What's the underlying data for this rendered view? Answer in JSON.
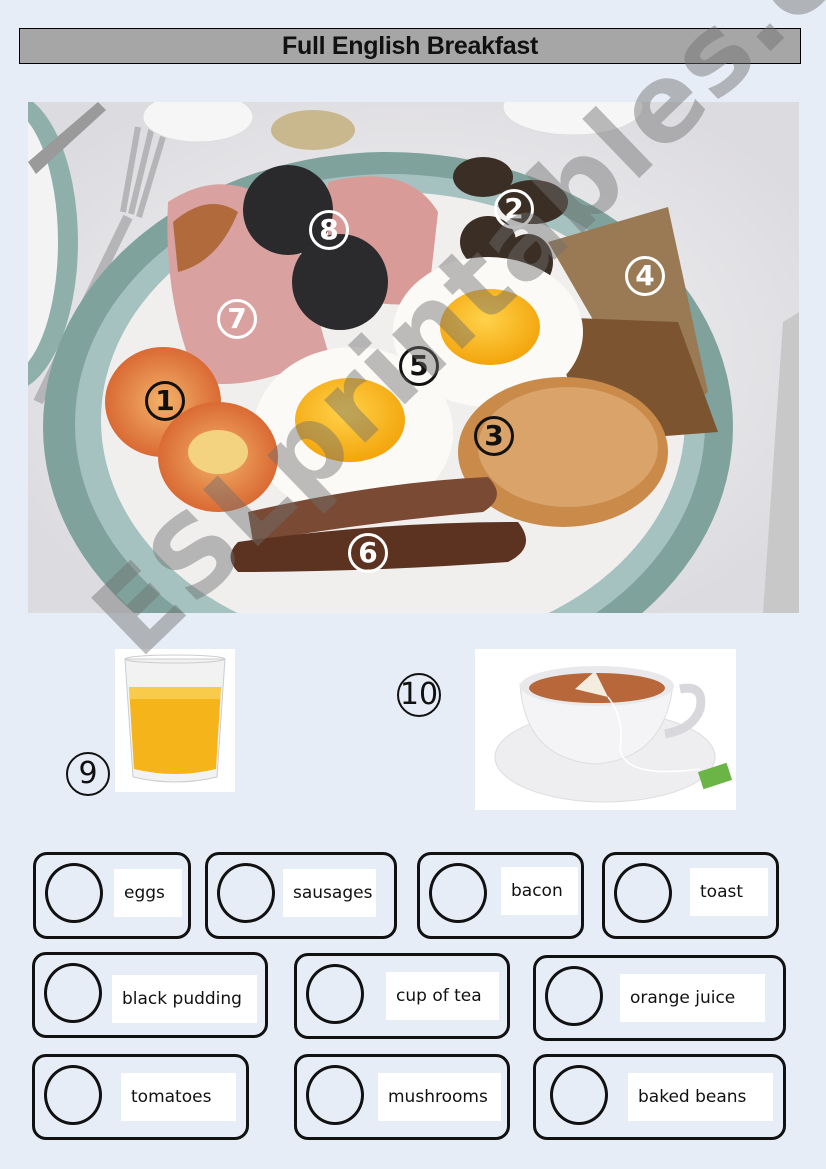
{
  "title": "Full English Breakfast",
  "photo": {
    "alt": "Plate of full English breakfast",
    "markers": [
      {
        "n": "1",
        "item": "tomatoes"
      },
      {
        "n": "2",
        "item": "mushrooms"
      },
      {
        "n": "3",
        "item": "baked beans"
      },
      {
        "n": "4",
        "item": "toast"
      },
      {
        "n": "5",
        "item": "eggs"
      },
      {
        "n": "6",
        "item": "sausages"
      },
      {
        "n": "7",
        "item": "bacon"
      },
      {
        "n": "8",
        "item": "black pudding"
      }
    ]
  },
  "extras": [
    {
      "n": "9",
      "image": "orange-juice-glass"
    },
    {
      "n": "10",
      "image": "cup-of-tea"
    }
  ],
  "watermark": "ESLprintables.com",
  "word_bank": [
    {
      "label": "eggs",
      "answer": ""
    },
    {
      "label": "sausages",
      "answer": ""
    },
    {
      "label": "bacon",
      "answer": ""
    },
    {
      "label": "toast",
      "answer": ""
    },
    {
      "label": "black pudding",
      "answer": ""
    },
    {
      "label": "cup of tea",
      "answer": ""
    },
    {
      "label": "orange juice",
      "answer": ""
    },
    {
      "label": "tomatoes",
      "answer": ""
    },
    {
      "label": "mushrooms",
      "answer": ""
    },
    {
      "label": "baked beans",
      "answer": ""
    }
  ],
  "colors": {
    "page_background": "#e6edf6",
    "title_bar": "#a6a6a6"
  }
}
